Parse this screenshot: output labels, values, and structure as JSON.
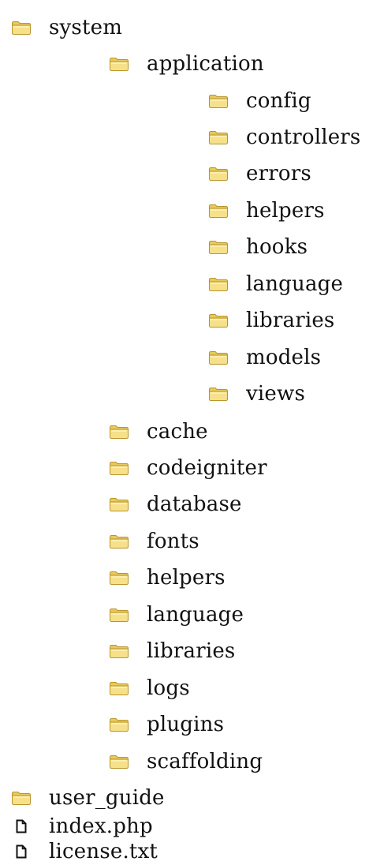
{
  "tree": {
    "items": [
      {
        "label": "system",
        "type": "folder",
        "depth": 0
      },
      {
        "label": "application",
        "type": "folder",
        "depth": 1
      },
      {
        "label": "config",
        "type": "folder",
        "depth": 2
      },
      {
        "label": "controllers",
        "type": "folder",
        "depth": 2
      },
      {
        "label": "errors",
        "type": "folder",
        "depth": 2
      },
      {
        "label": "helpers",
        "type": "folder",
        "depth": 2
      },
      {
        "label": "hooks",
        "type": "folder",
        "depth": 2
      },
      {
        "label": "language",
        "type": "folder",
        "depth": 2
      },
      {
        "label": "libraries",
        "type": "folder",
        "depth": 2
      },
      {
        "label": "models",
        "type": "folder",
        "depth": 2
      },
      {
        "label": "views",
        "type": "folder",
        "depth": 2
      },
      {
        "label": "cache",
        "type": "folder",
        "depth": 1
      },
      {
        "label": "codeigniter",
        "type": "folder",
        "depth": 1
      },
      {
        "label": "database",
        "type": "folder",
        "depth": 1
      },
      {
        "label": "fonts",
        "type": "folder",
        "depth": 1
      },
      {
        "label": "helpers",
        "type": "folder",
        "depth": 1
      },
      {
        "label": "language",
        "type": "folder",
        "depth": 1
      },
      {
        "label": "libraries",
        "type": "folder",
        "depth": 1
      },
      {
        "label": "logs",
        "type": "folder",
        "depth": 1
      },
      {
        "label": "plugins",
        "type": "folder",
        "depth": 1
      },
      {
        "label": "scaffolding",
        "type": "folder",
        "depth": 1
      },
      {
        "label": "user_guide",
        "type": "folder",
        "depth": 0
      },
      {
        "label": "index.php",
        "type": "file",
        "depth": 0
      },
      {
        "label": "license.txt",
        "type": "file",
        "depth": 0
      }
    ]
  },
  "icons": {
    "folder": "folder-icon",
    "file": "file-icon"
  },
  "colors": {
    "folder_fill": "#f6e08a",
    "folder_tab": "#e9c95a",
    "folder_stroke": "#b8962e",
    "file_stroke": "#111111",
    "text": "#111111"
  }
}
